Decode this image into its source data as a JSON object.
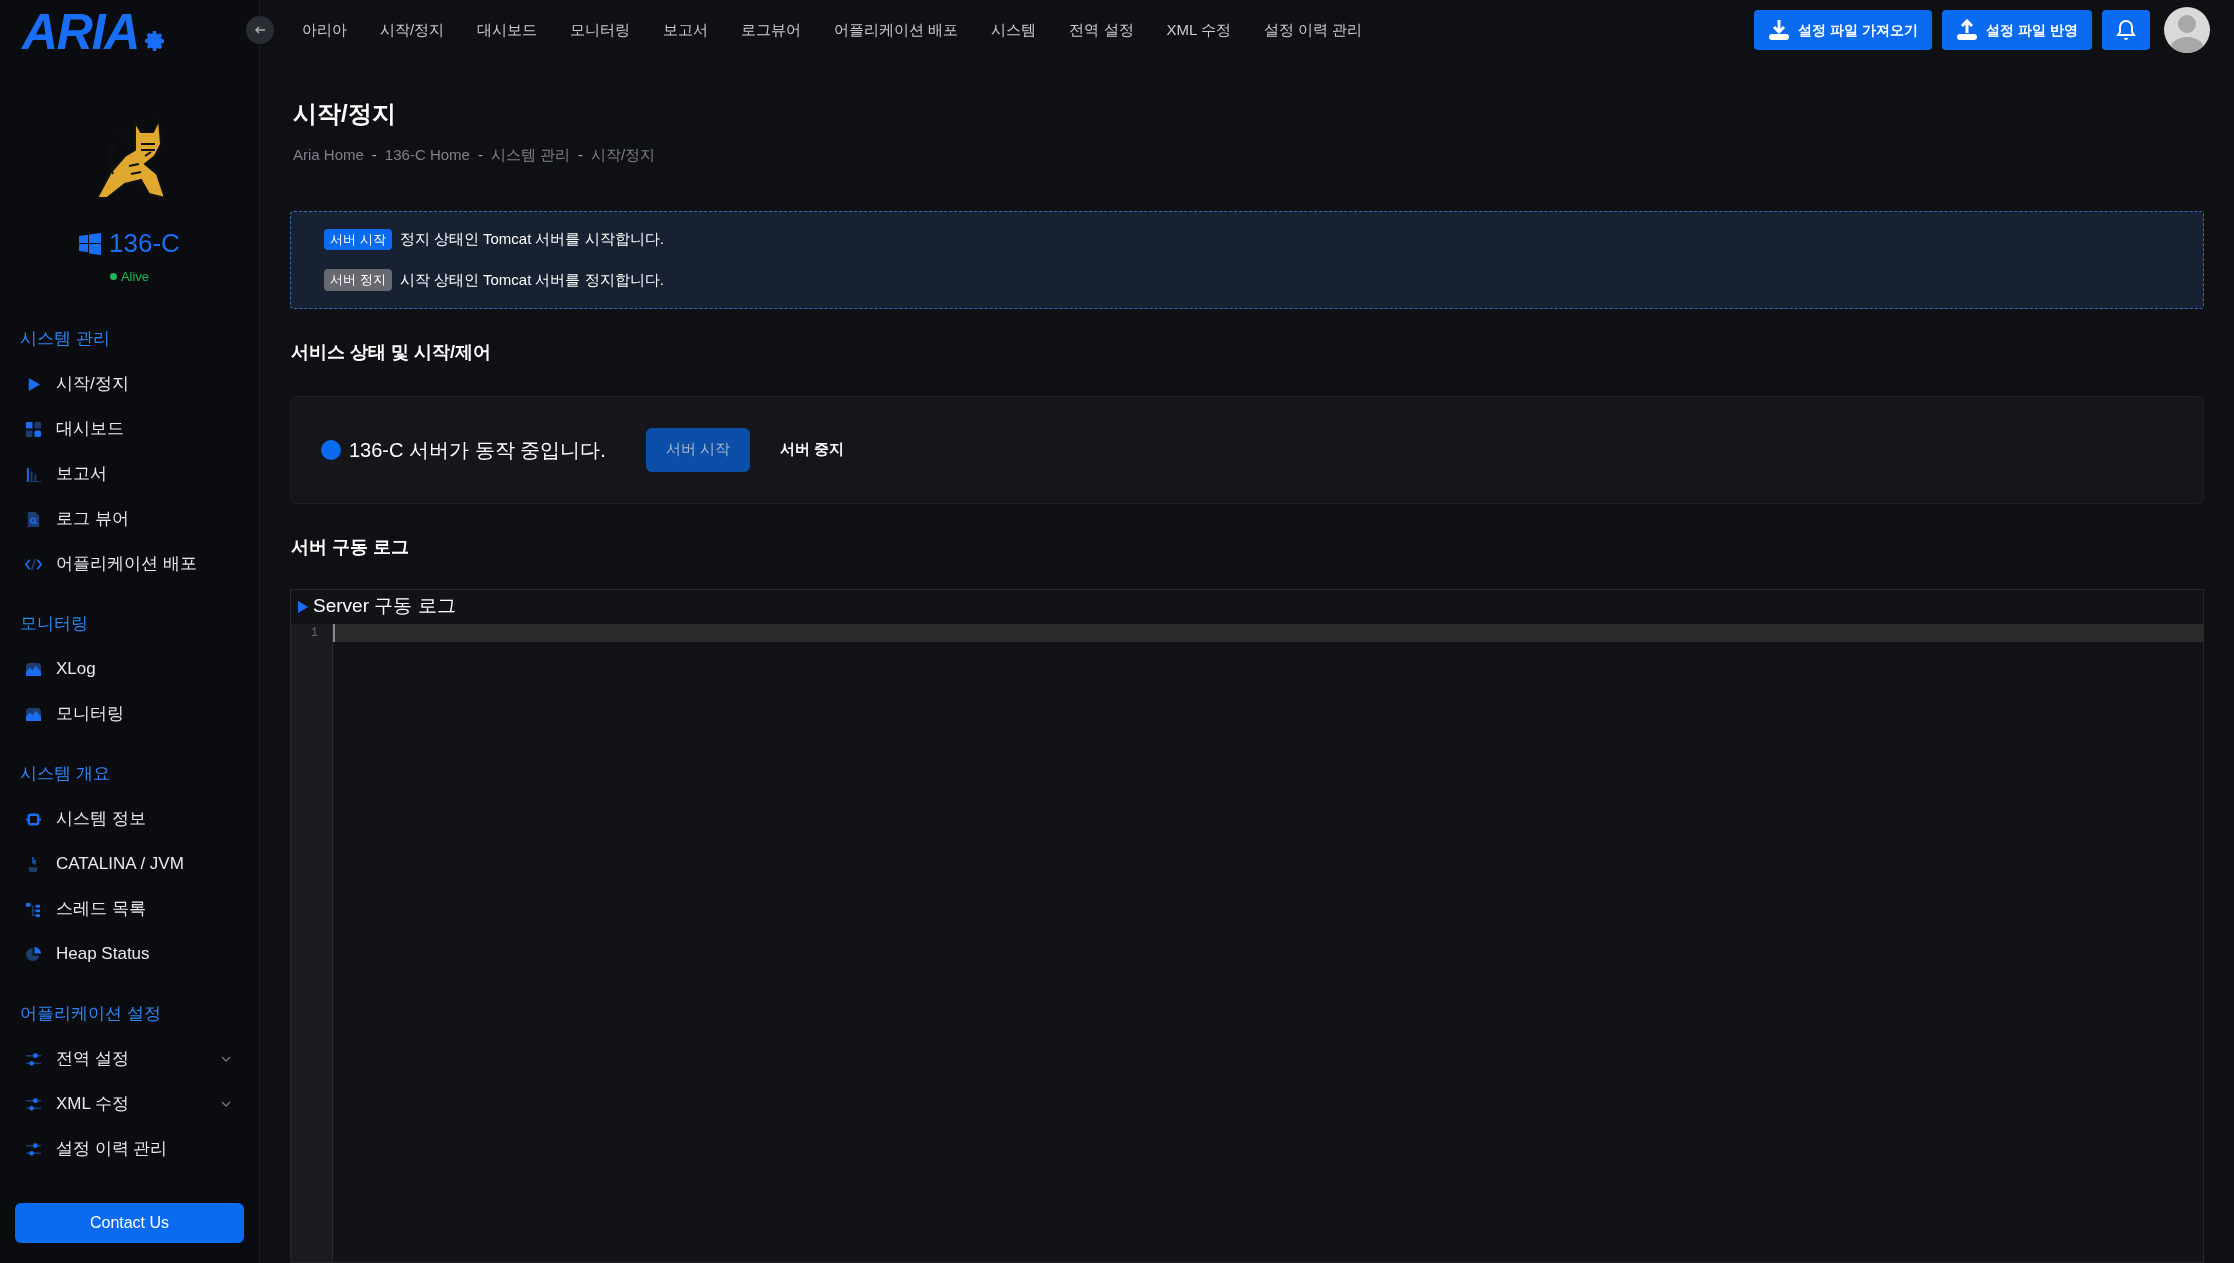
{
  "logo": "ARIA",
  "topbar": {
    "nav": [
      "아리아",
      "시작/정지",
      "대시보드",
      "모니터링",
      "보고서",
      "로그뷰어",
      "어플리케이션 배포",
      "시스템",
      "전역 설정",
      "XML 수정",
      "설정 이력 관리"
    ],
    "actions": [
      {
        "label": "설정 파일 가져오기",
        "kind": "download"
      },
      {
        "label": "설정 파일 반영",
        "kind": "upload"
      }
    ]
  },
  "sidebar": {
    "server": {
      "name": "136-C",
      "status": "Alive",
      "alive": true
    },
    "sections": [
      {
        "title": "시스템 관리",
        "items": [
          {
            "label": "시작/정지",
            "kind": "play",
            "expandable": false
          },
          {
            "label": "대시보드",
            "kind": "grid",
            "expandable": false
          },
          {
            "label": "보고서",
            "kind": "bars",
            "expandable": false
          },
          {
            "label": "로그 뷰어",
            "kind": "file",
            "expandable": false
          },
          {
            "label": "어플리케이션 배포",
            "kind": "code",
            "expandable": false
          }
        ]
      },
      {
        "title": "모니터링",
        "items": [
          {
            "label": "XLog",
            "kind": "wave",
            "expandable": false
          },
          {
            "label": "모니터링",
            "kind": "wave",
            "expandable": false
          }
        ]
      },
      {
        "title": "시스템 개요",
        "items": [
          {
            "label": "시스템 정보",
            "kind": "chip",
            "expandable": false
          },
          {
            "label": "CATALINA / JVM",
            "kind": "java",
            "expandable": false
          },
          {
            "label": "스레드 목록",
            "kind": "tree",
            "expandable": false
          },
          {
            "label": "Heap Status",
            "kind": "pie",
            "expandable": false
          }
        ]
      },
      {
        "title": "어플리케이션 설정",
        "items": [
          {
            "label": "전역 설정",
            "kind": "sliders",
            "expandable": true
          },
          {
            "label": "XML 수정",
            "kind": "sliders",
            "expandable": true
          },
          {
            "label": "설정 이력 관리",
            "kind": "sliders",
            "expandable": false
          }
        ]
      }
    ],
    "contact": "Contact Us"
  },
  "page": {
    "title": "시작/정지",
    "breadcrumb": [
      {
        "kind": "link",
        "text": "Aria Home"
      },
      {
        "kind": "separator",
        "text": "-"
      },
      {
        "kind": "link",
        "text": "136-C Home"
      },
      {
        "kind": "separator",
        "text": "-"
      },
      {
        "kind": "link",
        "text": "시스템 관리"
      },
      {
        "kind": "separator",
        "text": "-"
      },
      {
        "kind": "link",
        "text": "시작/정지"
      }
    ],
    "info": [
      {
        "badge": "서버 시작",
        "kind": "start",
        "text": "정지 상태인 Tomcat 서버를 시작합니다."
      },
      {
        "badge": "서버 정지",
        "kind": "stop",
        "text": "시작 상태인 Tomcat 서버를 정지합니다."
      }
    ],
    "status_heading": "서비스 상태 및 시작/제어",
    "status": {
      "running": true,
      "message": "136-C 서버가 동작 중입니다.",
      "buttons": [
        {
          "label": "서버 시작",
          "kind": "primary",
          "disabled": true
        },
        {
          "label": "서버 중지",
          "kind": "plain",
          "disabled": false
        }
      ]
    },
    "log_heading": "서버 구동 로그",
    "log": {
      "title": "Server 구동 로그",
      "expanded": false,
      "lines": [
        "1"
      ]
    }
  }
}
